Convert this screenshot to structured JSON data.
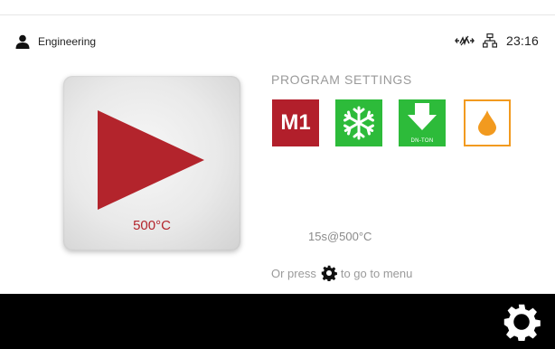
{
  "header": {
    "user_name": "Engineering",
    "time": "23:16"
  },
  "start": {
    "temperature": "500°C",
    "accent_color": "#b3242c"
  },
  "program": {
    "title": "PROGRAM SETTINGS",
    "m1_label": "M1",
    "down_label": "DN-TON",
    "time_temp": "15s@500°C"
  },
  "footer": {
    "hint_before": "Or press",
    "hint_after": "to go to menu"
  },
  "icons": [
    "user-icon",
    "connection-icon",
    "network-icon",
    "play-icon",
    "snowflake-icon",
    "down-arrow-icon",
    "drop-icon",
    "gear-icon"
  ],
  "colors": {
    "red": "#b21f2b",
    "green": "#2dbb3a",
    "orange": "#f29a1f",
    "bar": "#000000"
  }
}
